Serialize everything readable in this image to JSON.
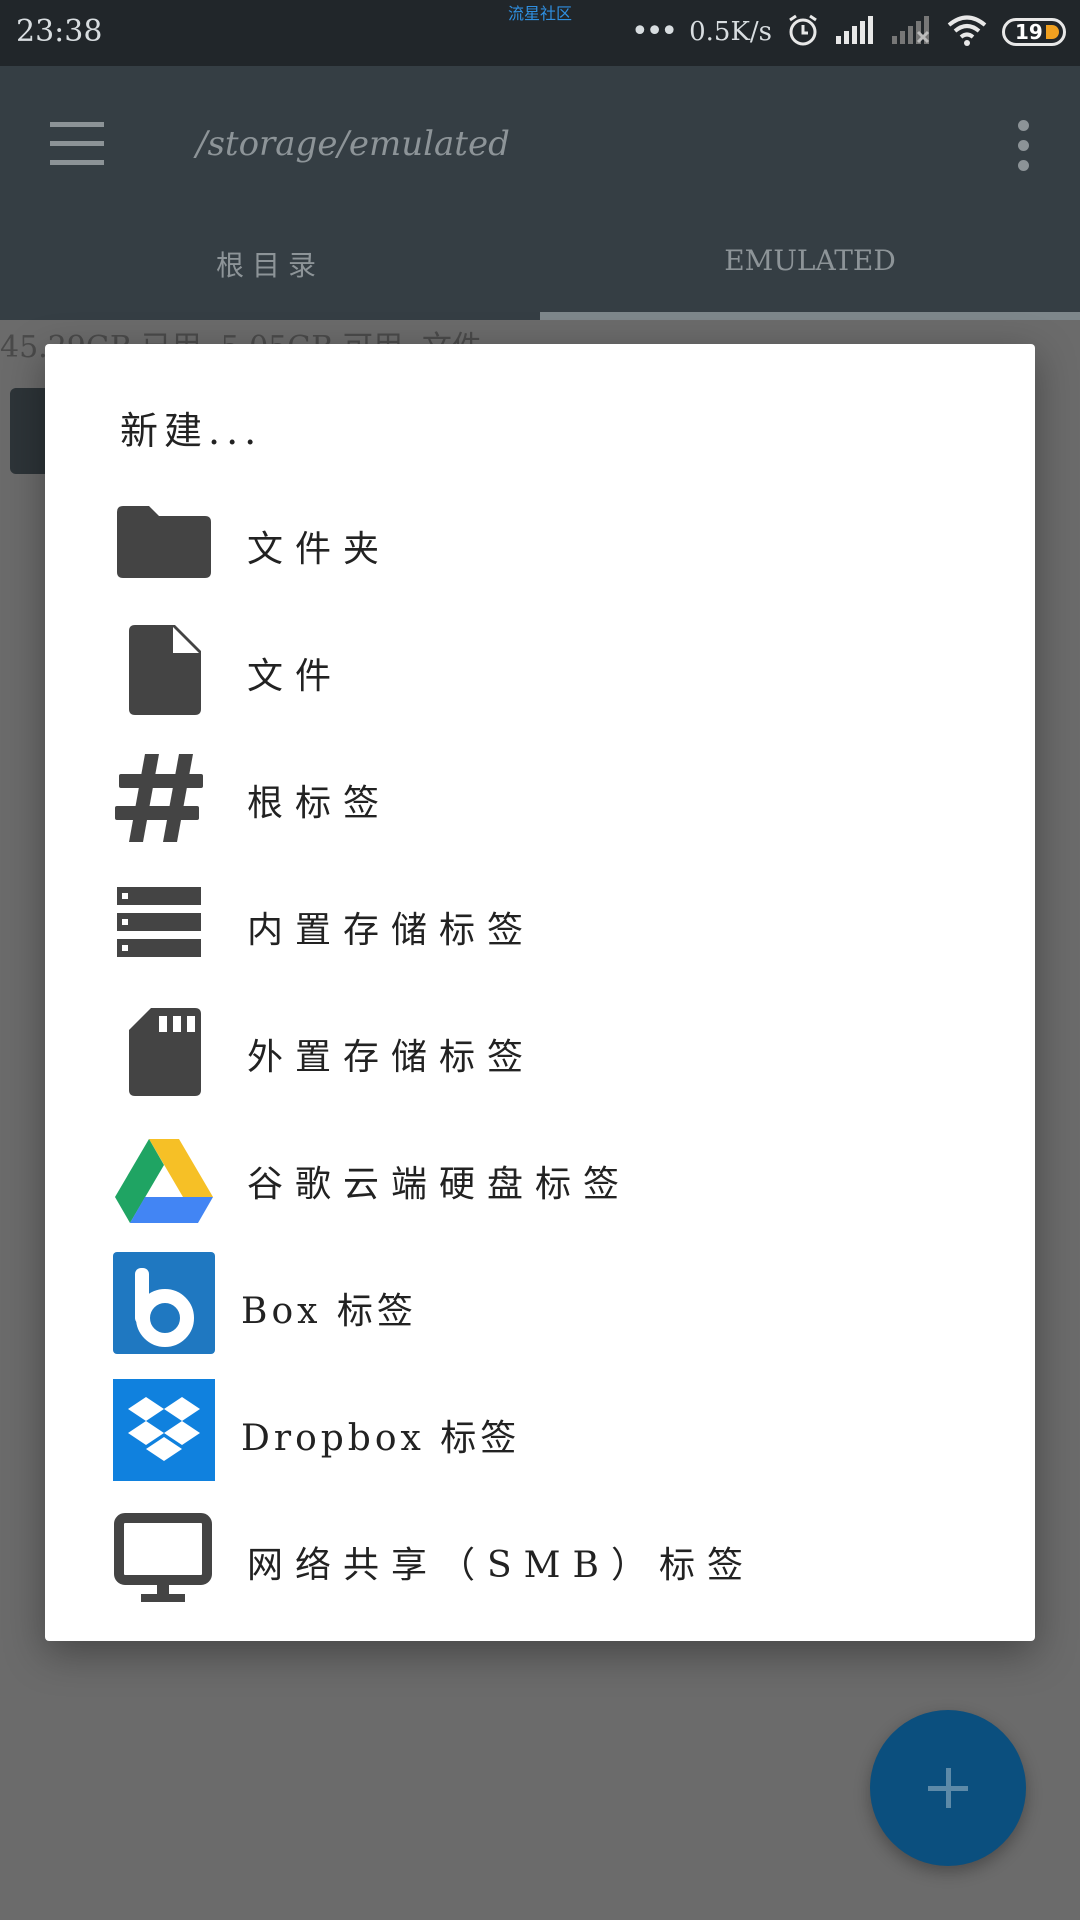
{
  "status_bar": {
    "time": "23:38",
    "carrier_label": "流星社区",
    "dots": "•••",
    "net_speed": "0.5K/s",
    "battery_level": "19",
    "icons": [
      "alarm-icon",
      "signal-icon",
      "signal-no-sim-icon",
      "wifi-icon",
      "battery-icon"
    ]
  },
  "app_bar": {
    "path": "/storage/emulated",
    "menu_icon": "hamburger-menu-icon",
    "overflow_icon": "more-vert-icon"
  },
  "tabs": [
    {
      "label": "根目录",
      "selected": false
    },
    {
      "label": "EMULATED",
      "selected": true
    }
  ],
  "storage_info": "45.29GB 已用, 5.05GB 可用, 文件",
  "dialog": {
    "title": "新建...",
    "items": [
      {
        "label": "文件夹",
        "icon": "folder-icon"
      },
      {
        "label": "文件",
        "icon": "file-icon"
      },
      {
        "label": "根标签",
        "icon": "hashtag-icon"
      },
      {
        "label": "内置存储标签",
        "icon": "storage-icon"
      },
      {
        "label": "外置存储标签",
        "icon": "sd-card-icon"
      },
      {
        "label": "谷歌云端硬盘标签",
        "icon": "google-drive-icon"
      },
      {
        "label": "Box 标签",
        "icon": "box-icon"
      },
      {
        "label": "Dropbox 标签",
        "icon": "dropbox-icon"
      },
      {
        "label": "网络共享（SMB）标签",
        "icon": "monitor-icon"
      }
    ]
  },
  "fab": {
    "icon": "plus-icon"
  },
  "colors": {
    "status_bar": "#21262a",
    "app_bar": "#353e44",
    "scrim": "#6b6b6b",
    "fab": "#0b4f7e",
    "icon_dark": "#444444",
    "box_blue": "#1f78c1",
    "dropbox_blue": "#1081de"
  }
}
